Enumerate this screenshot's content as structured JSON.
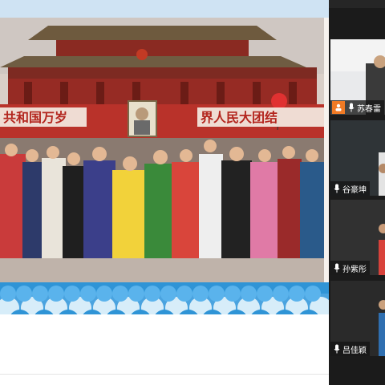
{
  "slide": {
    "banner_left": "共和国万岁",
    "banner_right": "界人民大团结"
  },
  "participants": [
    {
      "name": "苏春雷",
      "is_host": true,
      "muted": true
    },
    {
      "name": "谷豪坤",
      "is_host": false,
      "muted": true
    },
    {
      "name": "孙紫彤",
      "is_host": false,
      "muted": true,
      "active_speaker": true
    },
    {
      "name": "吕佳颖",
      "is_host": false,
      "muted": true
    }
  ],
  "colors": {
    "panel_bg": "#1b1b1b",
    "active_border": "#33c46c",
    "host_badge": "#f07a25",
    "wave_blue": "#2f94d6"
  },
  "icons": [
    "host-icon",
    "mic-icon"
  ]
}
